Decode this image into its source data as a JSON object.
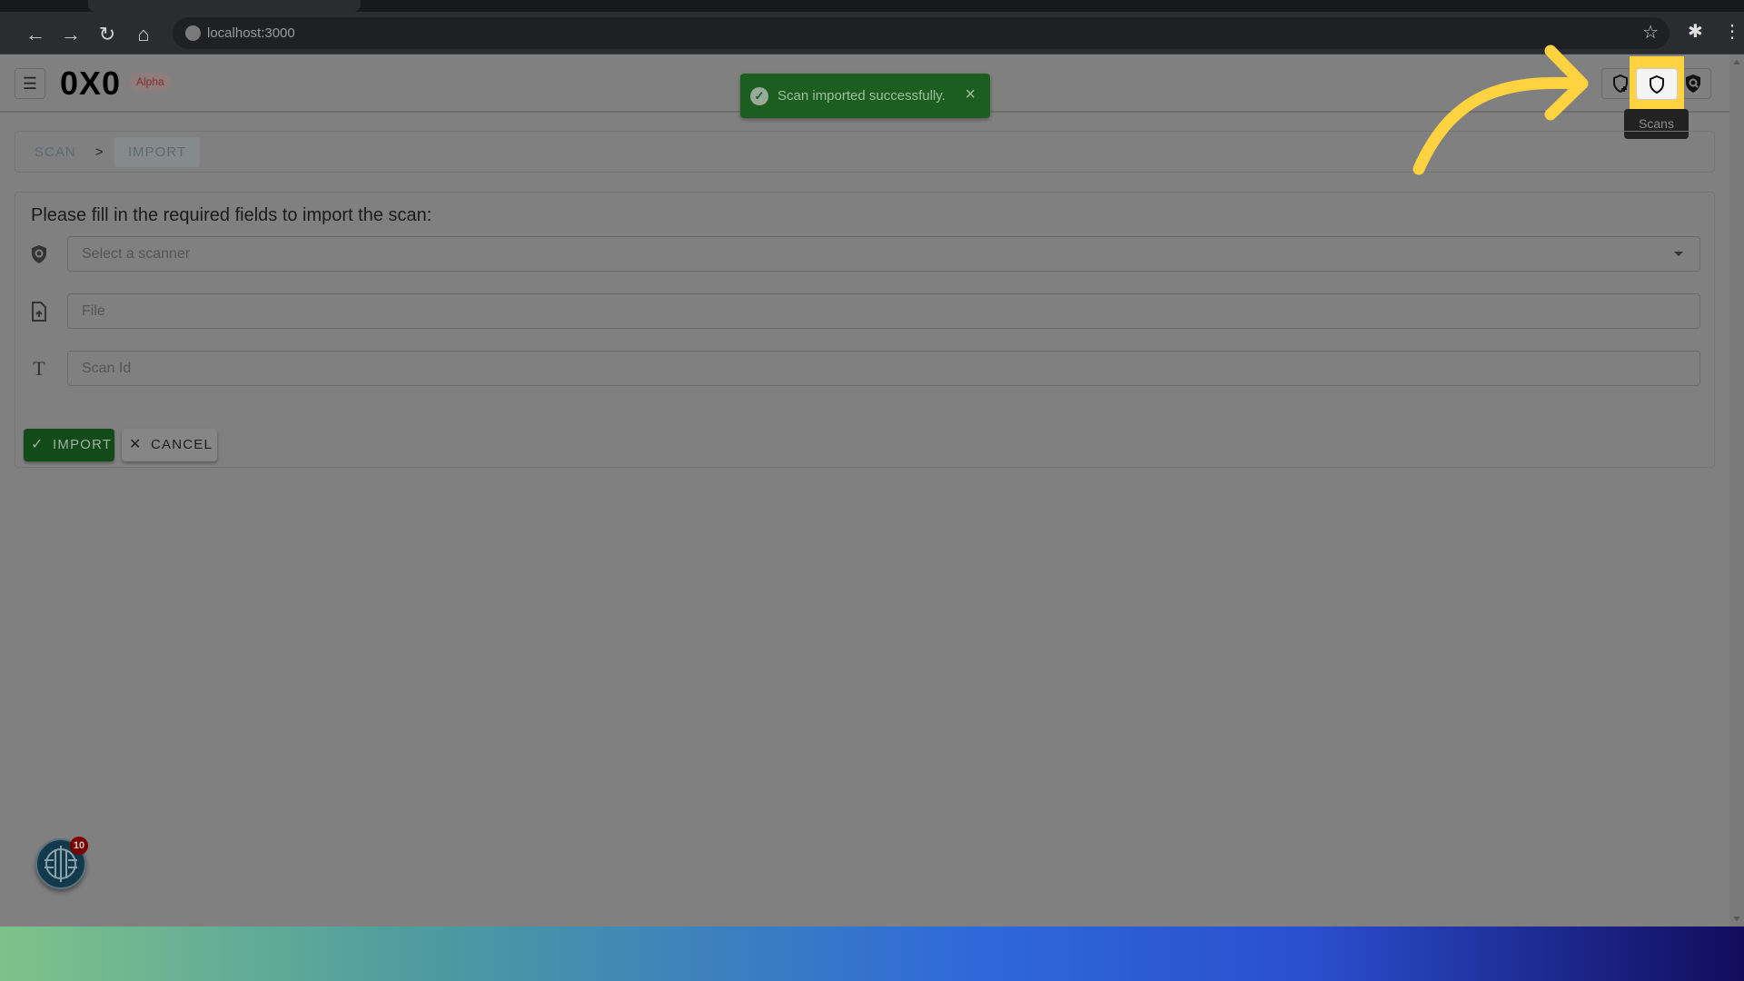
{
  "browser": {
    "url": "localhost:3000"
  },
  "header": {
    "logo": "0X0",
    "badge": "Alpha",
    "tooltip": "Scans"
  },
  "toast": {
    "message": "Scan imported successfully."
  },
  "breadcrumb": {
    "items": [
      "SCAN",
      "IMPORT"
    ],
    "separator": ">"
  },
  "form": {
    "title": "Please fill in the required fields to import the scan:",
    "scanner_placeholder": "Select a scanner",
    "file_placeholder": "File",
    "scan_id_placeholder": "Scan Id",
    "import_label": "IMPORT",
    "cancel_label": "CANCEL"
  },
  "notifications": {
    "count": "10"
  },
  "colors": {
    "accent_green": "#1b5e20",
    "highlight": "#ffd23f",
    "badge_red": "#7a0000"
  }
}
